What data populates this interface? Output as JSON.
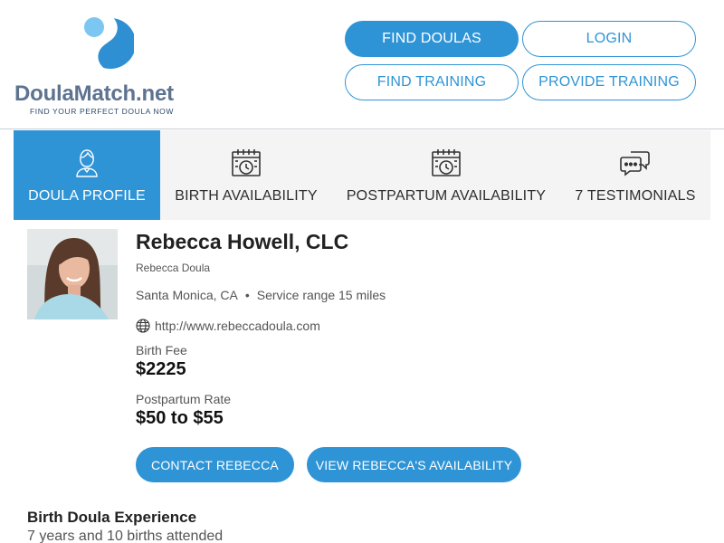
{
  "header": {
    "logo": {
      "brand": "DoulaMatch",
      "tld": ".net",
      "tagline": "FIND YOUR PERFECT DOULA NOW"
    },
    "nav": {
      "find_doulas": "FIND DOULAS",
      "login": "LOGIN",
      "find_training": "FIND TRAINING",
      "provide_training": "PROVIDE TRAINING"
    }
  },
  "tabs": [
    {
      "label": "DOULA PROFILE",
      "icon": "person-icon",
      "active": true
    },
    {
      "label": "BIRTH AVAILABILITY",
      "icon": "calendar-clock-icon",
      "active": false
    },
    {
      "label": "POSTPARTUM AVAILABILITY",
      "icon": "calendar-clock-icon",
      "active": false
    },
    {
      "label": "7 TESTIMONIALS",
      "icon": "chat-bubbles-icon",
      "active": false
    }
  ],
  "profile": {
    "name": "Rebecca Howell, CLC",
    "business": "Rebecca Doula",
    "location": "Santa Monica, CA",
    "service_range": "Service range 15 miles",
    "website": "http://www.rebeccadoula.com",
    "birth_fee_label": "Birth Fee",
    "birth_fee": "$2225",
    "postpartum_label": "Postpartum Rate",
    "postpartum_rate": "$50 to $55",
    "contact_button": "CONTACT REBECCA",
    "availability_button": "VIEW REBECCA'S AVAILABILITY"
  },
  "experience": {
    "heading": "Birth Doula Experience",
    "text": "7 years and 10 births attended"
  },
  "colors": {
    "accent": "#2f94d6",
    "logo_text": "#5d7390",
    "tab_bg": "#f4f4f4"
  }
}
